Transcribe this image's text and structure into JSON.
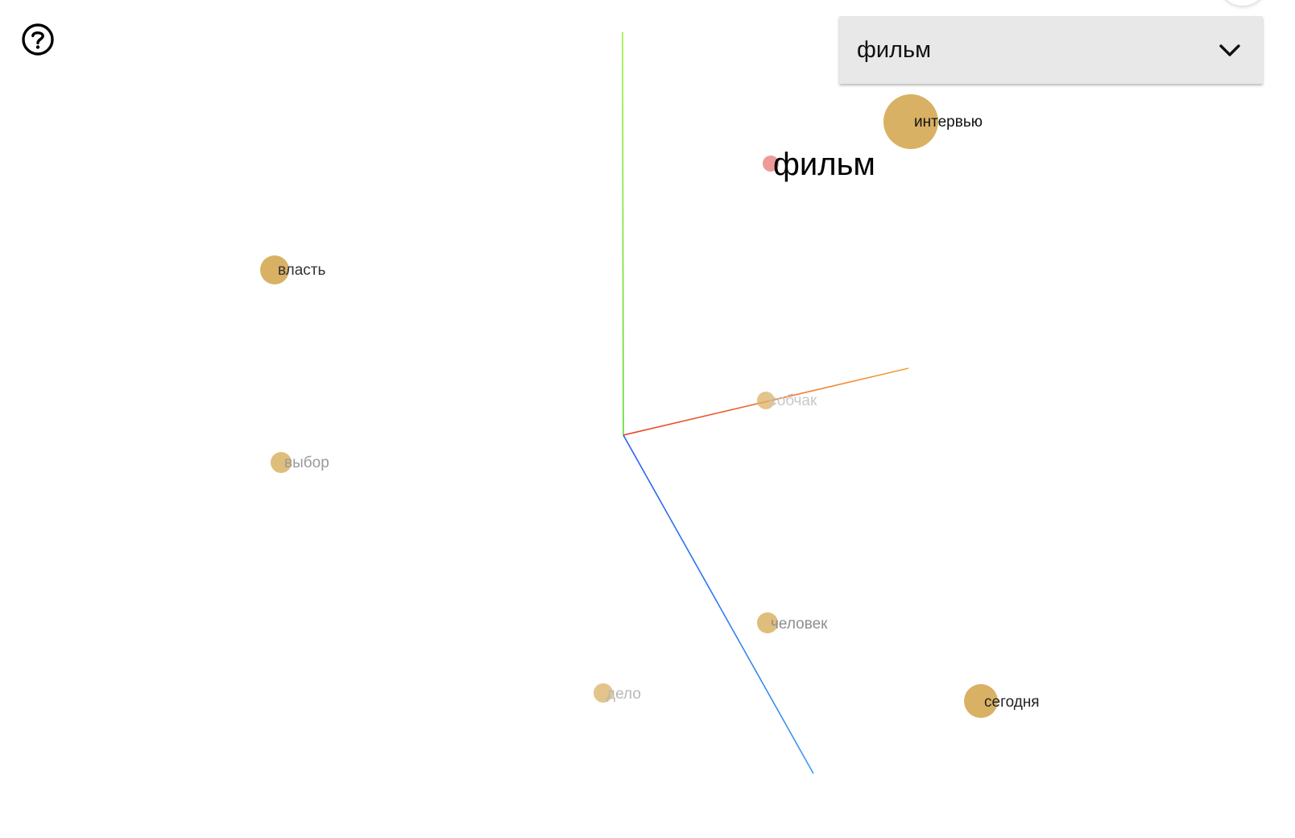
{
  "help": {
    "icon": "help-circle-icon"
  },
  "word_select": {
    "selected": "фильм",
    "icon": "chevron-down-icon"
  },
  "axes": {
    "x_color": "#e83a1f",
    "y_color": "#5bdc2a",
    "z_color": "#2a5ff0"
  },
  "colors": {
    "point": "#d9b164",
    "focus_point": "#ee9a9a"
  },
  "words": [
    {
      "label": "фильм",
      "focus": true
    },
    {
      "label": "интервью"
    },
    {
      "label": "власть"
    },
    {
      "label": "собчак"
    },
    {
      "label": "выбор"
    },
    {
      "label": "человек"
    },
    {
      "label": "дело"
    },
    {
      "label": "сегодня"
    }
  ]
}
